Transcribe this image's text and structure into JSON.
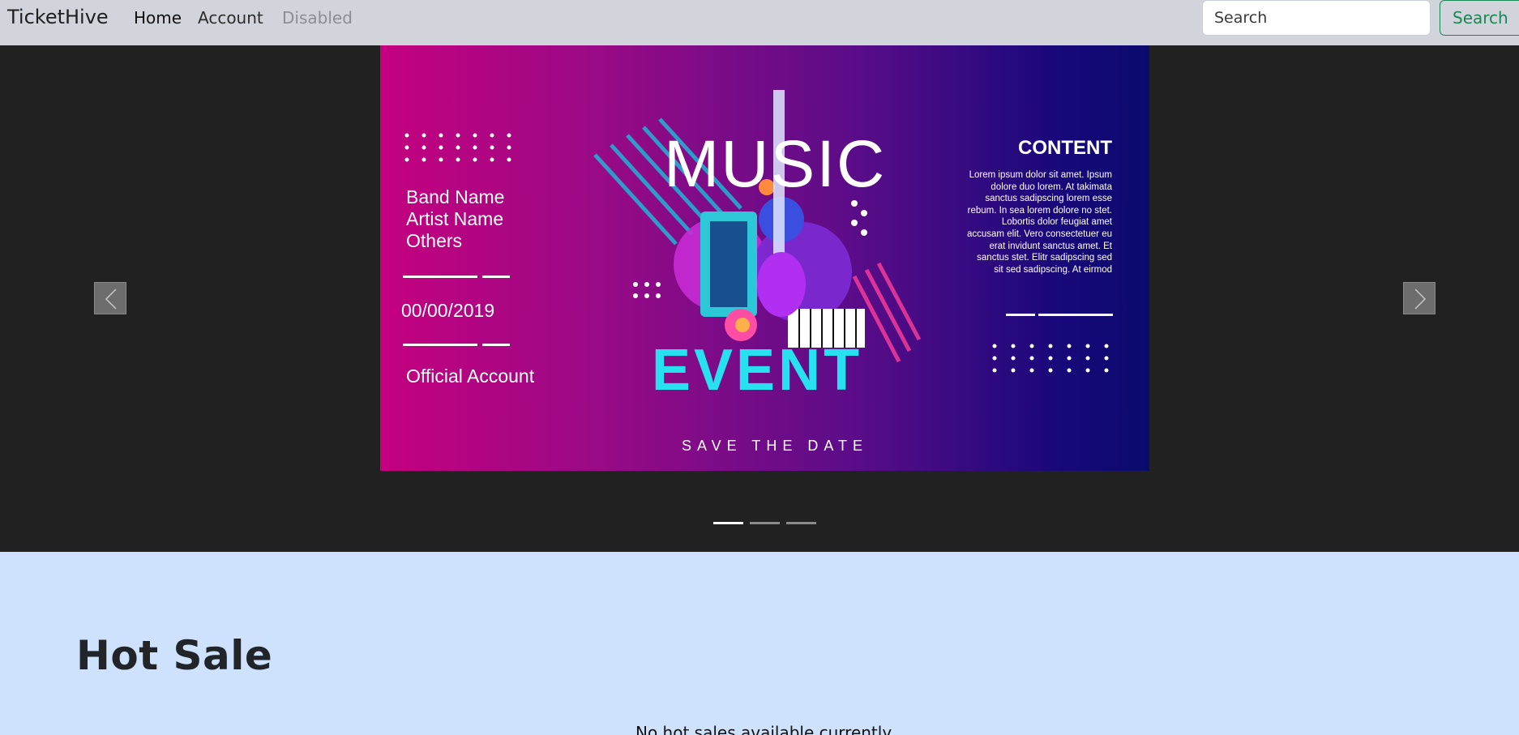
{
  "navbar": {
    "brand": "TicketHive",
    "links": [
      "Home",
      "Account",
      "Disabled"
    ],
    "search_placeholder": "Search",
    "search_button": "Search"
  },
  "carousel": {
    "slide": {
      "left_lines": [
        "Band Name",
        "Artist Name",
        "Others"
      ],
      "date": "00/00/2019",
      "official": "Official Account",
      "music": "MUSIC",
      "event": "EVENT",
      "save_the_date": "SAVE THE DATE",
      "content_title": "CONTENT",
      "content_body": "Lorem ipsum dolor sit amet. Ipsum dolore duo lorem. At takimata sanctus sadipscing lorem esse rebum. In sea lorem dolore no stet. Lobortis dolor feugiat amet accusam elit. Vero consectetuer eu erat invidunt sanctus amet. Et sanctus stet. Elitr sadipscing sed sit sed sadipscing. At eirmod"
    },
    "prev_icon": "chevron-left-icon",
    "next_icon": "chevron-right-icon",
    "indicator_count": 3,
    "active_indicator": 1
  },
  "hot_sale": {
    "title": "Hot Sale",
    "empty_message": "No hot sales available currently"
  },
  "colors": {
    "navbar_bg": "#d1d5db",
    "carousel_bg": "#212121",
    "page_bg": "#cfe2fd",
    "success": "#198754"
  }
}
